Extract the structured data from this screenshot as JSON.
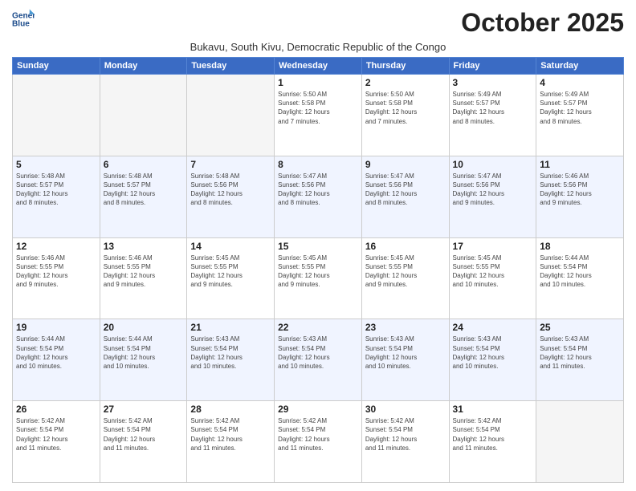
{
  "logo": {
    "line1": "General",
    "line2": "Blue"
  },
  "title": "October 2025",
  "subtitle": "Bukavu, South Kivu, Democratic Republic of the Congo",
  "weekdays": [
    "Sunday",
    "Monday",
    "Tuesday",
    "Wednesday",
    "Thursday",
    "Friday",
    "Saturday"
  ],
  "weeks": [
    [
      {
        "day": "",
        "info": ""
      },
      {
        "day": "",
        "info": ""
      },
      {
        "day": "",
        "info": ""
      },
      {
        "day": "1",
        "info": "Sunrise: 5:50 AM\nSunset: 5:58 PM\nDaylight: 12 hours\nand 7 minutes."
      },
      {
        "day": "2",
        "info": "Sunrise: 5:50 AM\nSunset: 5:58 PM\nDaylight: 12 hours\nand 7 minutes."
      },
      {
        "day": "3",
        "info": "Sunrise: 5:49 AM\nSunset: 5:57 PM\nDaylight: 12 hours\nand 8 minutes."
      },
      {
        "day": "4",
        "info": "Sunrise: 5:49 AM\nSunset: 5:57 PM\nDaylight: 12 hours\nand 8 minutes."
      }
    ],
    [
      {
        "day": "5",
        "info": "Sunrise: 5:48 AM\nSunset: 5:57 PM\nDaylight: 12 hours\nand 8 minutes."
      },
      {
        "day": "6",
        "info": "Sunrise: 5:48 AM\nSunset: 5:57 PM\nDaylight: 12 hours\nand 8 minutes."
      },
      {
        "day": "7",
        "info": "Sunrise: 5:48 AM\nSunset: 5:56 PM\nDaylight: 12 hours\nand 8 minutes."
      },
      {
        "day": "8",
        "info": "Sunrise: 5:47 AM\nSunset: 5:56 PM\nDaylight: 12 hours\nand 8 minutes."
      },
      {
        "day": "9",
        "info": "Sunrise: 5:47 AM\nSunset: 5:56 PM\nDaylight: 12 hours\nand 8 minutes."
      },
      {
        "day": "10",
        "info": "Sunrise: 5:47 AM\nSunset: 5:56 PM\nDaylight: 12 hours\nand 9 minutes."
      },
      {
        "day": "11",
        "info": "Sunrise: 5:46 AM\nSunset: 5:56 PM\nDaylight: 12 hours\nand 9 minutes."
      }
    ],
    [
      {
        "day": "12",
        "info": "Sunrise: 5:46 AM\nSunset: 5:55 PM\nDaylight: 12 hours\nand 9 minutes."
      },
      {
        "day": "13",
        "info": "Sunrise: 5:46 AM\nSunset: 5:55 PM\nDaylight: 12 hours\nand 9 minutes."
      },
      {
        "day": "14",
        "info": "Sunrise: 5:45 AM\nSunset: 5:55 PM\nDaylight: 12 hours\nand 9 minutes."
      },
      {
        "day": "15",
        "info": "Sunrise: 5:45 AM\nSunset: 5:55 PM\nDaylight: 12 hours\nand 9 minutes."
      },
      {
        "day": "16",
        "info": "Sunrise: 5:45 AM\nSunset: 5:55 PM\nDaylight: 12 hours\nand 9 minutes."
      },
      {
        "day": "17",
        "info": "Sunrise: 5:45 AM\nSunset: 5:55 PM\nDaylight: 12 hours\nand 10 minutes."
      },
      {
        "day": "18",
        "info": "Sunrise: 5:44 AM\nSunset: 5:54 PM\nDaylight: 12 hours\nand 10 minutes."
      }
    ],
    [
      {
        "day": "19",
        "info": "Sunrise: 5:44 AM\nSunset: 5:54 PM\nDaylight: 12 hours\nand 10 minutes."
      },
      {
        "day": "20",
        "info": "Sunrise: 5:44 AM\nSunset: 5:54 PM\nDaylight: 12 hours\nand 10 minutes."
      },
      {
        "day": "21",
        "info": "Sunrise: 5:43 AM\nSunset: 5:54 PM\nDaylight: 12 hours\nand 10 minutes."
      },
      {
        "day": "22",
        "info": "Sunrise: 5:43 AM\nSunset: 5:54 PM\nDaylight: 12 hours\nand 10 minutes."
      },
      {
        "day": "23",
        "info": "Sunrise: 5:43 AM\nSunset: 5:54 PM\nDaylight: 12 hours\nand 10 minutes."
      },
      {
        "day": "24",
        "info": "Sunrise: 5:43 AM\nSunset: 5:54 PM\nDaylight: 12 hours\nand 10 minutes."
      },
      {
        "day": "25",
        "info": "Sunrise: 5:43 AM\nSunset: 5:54 PM\nDaylight: 12 hours\nand 11 minutes."
      }
    ],
    [
      {
        "day": "26",
        "info": "Sunrise: 5:42 AM\nSunset: 5:54 PM\nDaylight: 12 hours\nand 11 minutes."
      },
      {
        "day": "27",
        "info": "Sunrise: 5:42 AM\nSunset: 5:54 PM\nDaylight: 12 hours\nand 11 minutes."
      },
      {
        "day": "28",
        "info": "Sunrise: 5:42 AM\nSunset: 5:54 PM\nDaylight: 12 hours\nand 11 minutes."
      },
      {
        "day": "29",
        "info": "Sunrise: 5:42 AM\nSunset: 5:54 PM\nDaylight: 12 hours\nand 11 minutes."
      },
      {
        "day": "30",
        "info": "Sunrise: 5:42 AM\nSunset: 5:54 PM\nDaylight: 12 hours\nand 11 minutes."
      },
      {
        "day": "31",
        "info": "Sunrise: 5:42 AM\nSunset: 5:54 PM\nDaylight: 12 hours\nand 11 minutes."
      },
      {
        "day": "",
        "info": ""
      }
    ]
  ]
}
